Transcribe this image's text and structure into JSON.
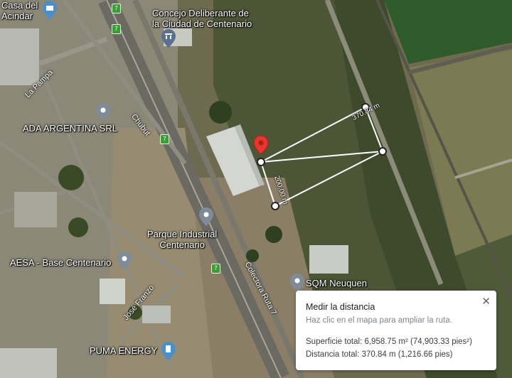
{
  "places": [
    {
      "id": "casa-acindar",
      "label": "Casa del\nAcindar"
    },
    {
      "id": "concejo",
      "label": "Concejo Deliberante de\nla Ciudad de Centenario"
    },
    {
      "id": "ada",
      "label": "ADA ARGENTINA SRL"
    },
    {
      "id": "parque",
      "label": "Parque Industrial\nCentenario"
    },
    {
      "id": "aesa",
      "label": "AESA - Base Centenario"
    },
    {
      "id": "sqm",
      "label": "SQM Neuquen"
    },
    {
      "id": "puma",
      "label": "PUMA ENERGY"
    }
  ],
  "roads": {
    "la_pampa": "La Pampa",
    "chubut": "Chubut",
    "colectora": "Colectora Ruta 7",
    "jose_franzo": "José Franzo"
  },
  "route_shield": "7",
  "measure": {
    "segment_long": "370.84 m",
    "segment_short": "200.00 m"
  },
  "panel": {
    "title": "Medir la distancia",
    "hint": "Haz clic en el mapa para ampliar la ruta.",
    "area": "Superficie total: 6,958.75 m² (74,903.33 pies²)",
    "distance": "Distancia total: 370.84 m (1,216.66 pies)",
    "close": "✕"
  },
  "colors": {
    "pin": "#4a8fc7",
    "marker": "#e8362f",
    "shield": "#3f9a3a",
    "measure_line": "#ffffff"
  }
}
